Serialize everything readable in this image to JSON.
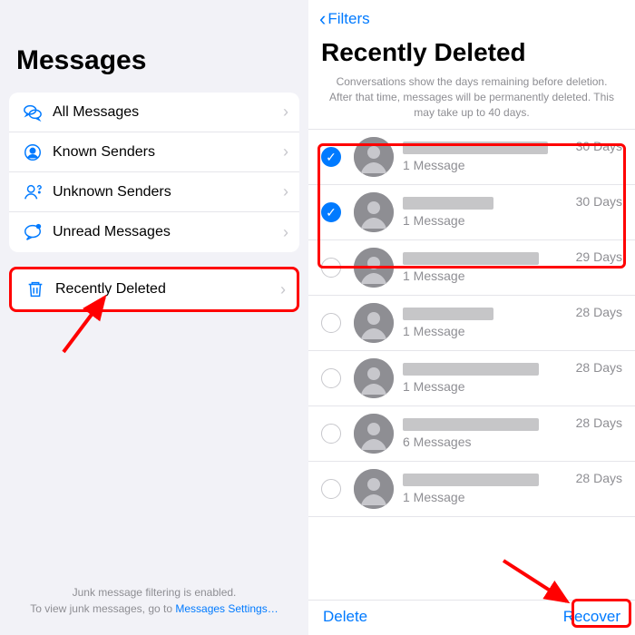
{
  "left": {
    "title": "Messages",
    "filters": [
      {
        "label": "All Messages"
      },
      {
        "label": "Known Senders"
      },
      {
        "label": "Unknown Senders"
      },
      {
        "label": "Unread Messages"
      }
    ],
    "recently_deleted_label": "Recently Deleted",
    "footer_line1": "Junk message filtering is enabled.",
    "footer_line2": "To view junk messages, go to ",
    "footer_link": "Messages Settings…"
  },
  "right": {
    "back_label": "Filters",
    "title": "Recently Deleted",
    "info": "Conversations show the days remaining before deletion. After that time, messages will be permanently deleted. This may take up to 40 days.",
    "conversations": [
      {
        "checked": true,
        "count_label": "1 Message",
        "days_label": "30 Days",
        "name_width": 160
      },
      {
        "checked": true,
        "count_label": "1 Message",
        "days_label": "30 Days",
        "name_width": 100
      },
      {
        "checked": false,
        "count_label": "1 Message",
        "days_label": "29 Days",
        "name_width": 150
      },
      {
        "checked": false,
        "count_label": "1 Message",
        "days_label": "28 Days",
        "name_width": 100
      },
      {
        "checked": false,
        "count_label": "1 Message",
        "days_label": "28 Days",
        "name_width": 150
      },
      {
        "checked": false,
        "count_label": "6 Messages",
        "days_label": "28 Days",
        "name_width": 150
      },
      {
        "checked": false,
        "count_label": "1 Message",
        "days_label": "28 Days",
        "name_width": 150
      }
    ],
    "delete_label": "Delete",
    "recover_label": "Recover"
  }
}
